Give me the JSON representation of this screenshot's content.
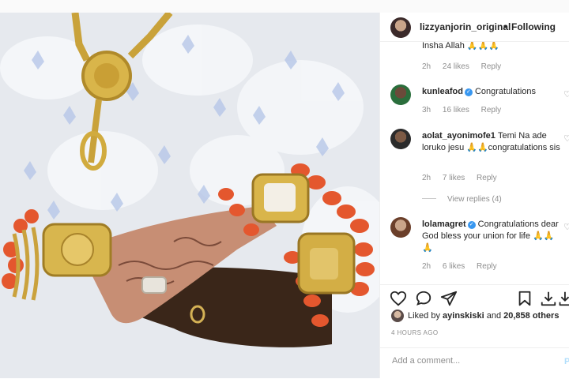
{
  "post": {
    "username": "lizzyanjorin_original",
    "follow_status": "Following",
    "separator": "•"
  },
  "comments": [
    {
      "username": "",
      "text": "Insha Allah 🙏🙏🙏",
      "time": "2h",
      "likes": "24 likes",
      "reply": "Reply",
      "verified": false
    },
    {
      "username": "kunleafod",
      "text": "Congratulations",
      "time": "3h",
      "likes": "16 likes",
      "reply": "Reply",
      "verified": true
    },
    {
      "username": "aolat_ayonimofe1",
      "text": "Temi Na ade loruko jesu 🙏🙏congratulations sis",
      "time": "2h",
      "likes": "7 likes",
      "reply": "Reply",
      "verified": false
    },
    {
      "username": "lolamagret",
      "text": "Congratulations dear God bless your union for life 🙏🙏🙏",
      "time": "2h",
      "likes": "6 likes",
      "reply": "Reply",
      "verified": true
    }
  ],
  "view_replies": "View replies (4)",
  "liked_by": {
    "prefix": "Liked by",
    "user": "ayinskiski",
    "joiner": "and",
    "others": "20,858 others"
  },
  "timestamp": "4 HOURS AGO",
  "add_comment": {
    "placeholder": "Add a comment...",
    "post_label": "P"
  },
  "icons": [
    "heart-icon",
    "comment-icon",
    "share-icon",
    "bookmark-icon",
    "download-icon"
  ]
}
